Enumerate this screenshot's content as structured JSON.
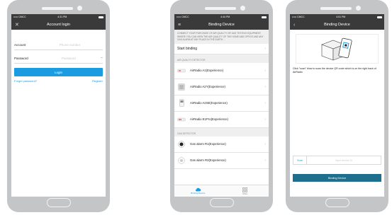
{
  "colors": {
    "accent": "#1c9ce0",
    "header": "#3a3a3a",
    "phone": "#c4c5c7",
    "bind_button": "#1e6f8d"
  },
  "login": {
    "status": {
      "carrier": "••••• CMCC",
      "time": "4:31 PM"
    },
    "title": "Account login",
    "close_icon": "close-icon",
    "account_label": "Account",
    "account_placeholder": "Phone number",
    "password_label": "Password",
    "password_placeholder": "Password",
    "login_label": "Login",
    "forgot_label": "Forget password?",
    "register_label": "Register"
  },
  "binding": {
    "status": {
      "carrier": "••••• CMCC",
      "time": "4:44 PM"
    },
    "title": "Binding Device",
    "intro": "CONNECT YOUR PURCHASE OF AIR QUALITY OR GAS TESTING EQUIPMENT, WHERE YOU CAN VIEW THE AIR QUALITY OF THE HOME AND OFFICE AND ANY GAS ALARM AT ANY PLACE IN THE EARTH ...",
    "start_label": "Start binding",
    "air_section": "AIR QUALITY DETECTOR",
    "air_devices": [
      {
        "name": "AirRadio A1(Experience)"
      },
      {
        "name": "AirRadio A2Y(Experience)"
      },
      {
        "name": "AirRadio A2SE(Experience)"
      },
      {
        "name": "AirRadio E1Pro(Experience)"
      }
    ],
    "gas_section": "GAS DETECTOR",
    "gas_devices": [
      {
        "name": "Gas alarm R1(Experience)"
      },
      {
        "name": "Gas alarm R2(Experience)"
      }
    ],
    "tabs": [
      {
        "label": "Binding Device"
      },
      {
        "label": "More"
      }
    ]
  },
  "scan": {
    "status": {
      "carrier": "••••• CMCC",
      "time": "4:51 PM"
    },
    "title": "Binding Device",
    "hint": "Click \"scan\" blow to scan the device QR code which is on the right back of AirRadio",
    "scan_label": "Scan",
    "input_placeholder": "Input device ID",
    "bind_label": "Binding Device"
  }
}
